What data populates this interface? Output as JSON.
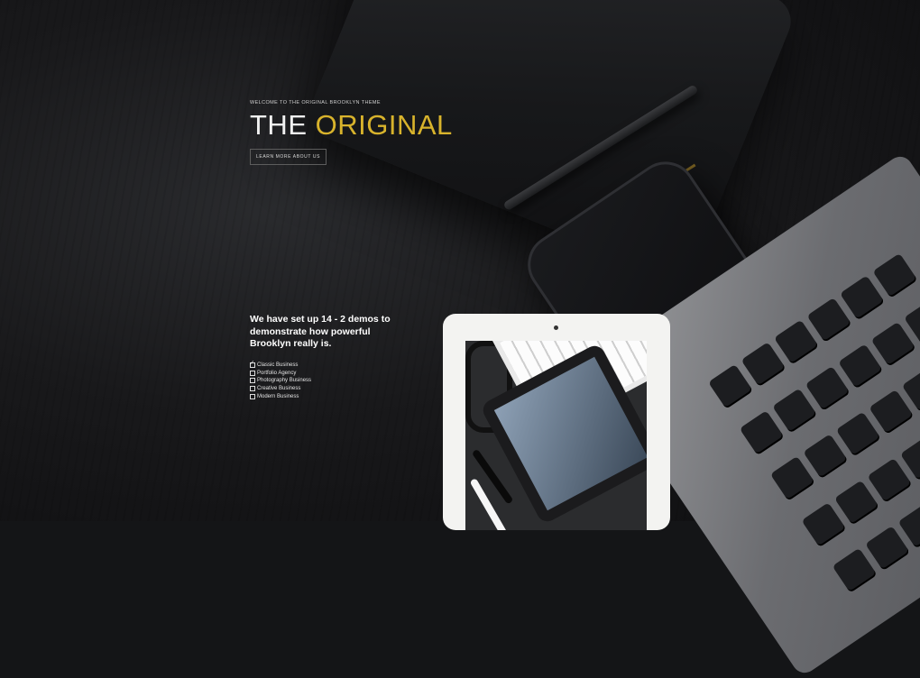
{
  "hero": {
    "kicker": "WELCOME TO THE ORIGINAL BROOKLYN THEME",
    "title_main": "THE ",
    "title_accent": "ORIGINAL",
    "cta_label": "LEARN MORE ABOUT US",
    "accent_color": "#d8b32c"
  },
  "demos": {
    "heading": "We have set up 14 - 2 demos to demonstrate how powerful Brooklyn really is.",
    "items": [
      {
        "label": "Classic Business",
        "checked": true
      },
      {
        "label": "Portfolio Agency",
        "checked": false
      },
      {
        "label": "Photography Business",
        "checked": false
      },
      {
        "label": "Creative Business",
        "checked": false
      },
      {
        "label": "Modern Business",
        "checked": false
      }
    ]
  }
}
